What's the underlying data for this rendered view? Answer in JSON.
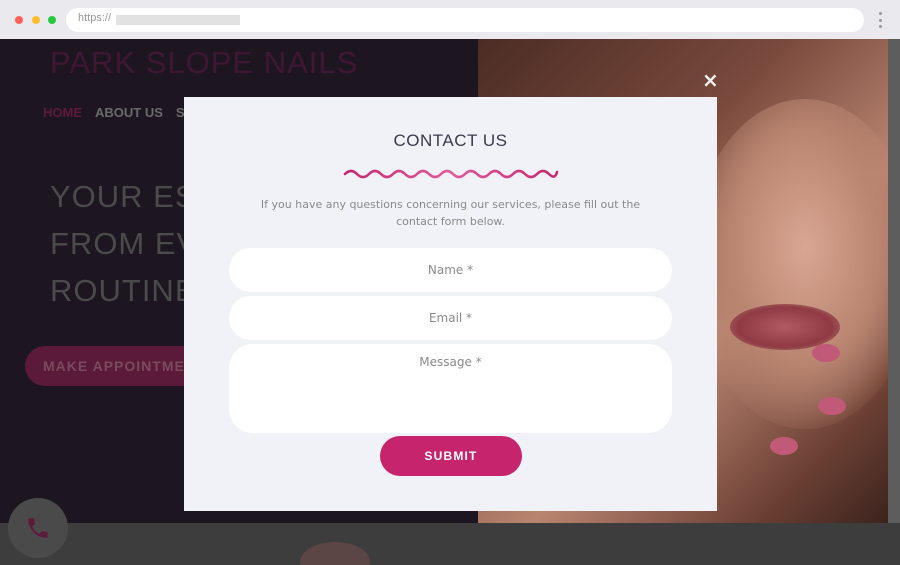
{
  "browser": {
    "url_prefix": "https://"
  },
  "site": {
    "logo": "PARK SLOPE NAILS",
    "nav": {
      "home": "HOME",
      "about": "ABOUT US",
      "partial": "S"
    },
    "headline_lines": [
      "YOUR ES",
      "FROM EV",
      "ROUTINE"
    ],
    "cta_label": "MAKE APPOINTME"
  },
  "modal": {
    "close_symbol": "×",
    "title": "CONTACT US",
    "description": "If you have any questions concerning our services, please fill out the contact form below.",
    "fields": {
      "name_placeholder": "Name *",
      "email_placeholder": "Email *",
      "message_placeholder": "Message *"
    },
    "submit_label": "SUBMIT"
  },
  "colors": {
    "accent": "#c6256e",
    "modal_bg": "#f1f2f8",
    "overlay_dark": "#1d1621"
  },
  "icons": {
    "phone_fab": "phone-icon",
    "menu": "kebab-menu-icon",
    "close": "close-icon"
  }
}
